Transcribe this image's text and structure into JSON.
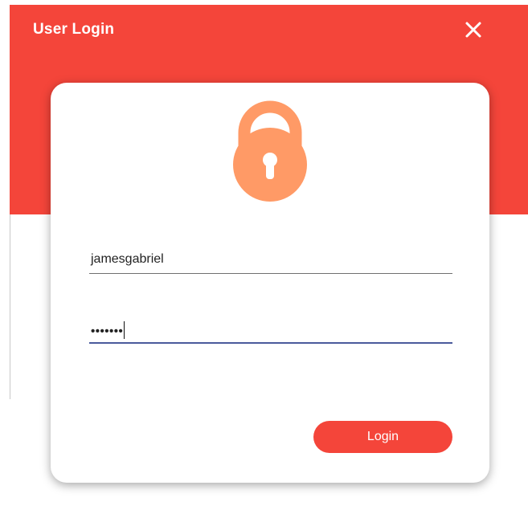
{
  "window": {
    "title": "User Login",
    "accent_color": "#f4453a"
  },
  "icons": {
    "close": "close-icon",
    "lock": "lock-icon",
    "lock_color": "#ff9a66"
  },
  "form": {
    "username_value": "jamesgabriel",
    "password_value": "•••••••",
    "login_label": "Login"
  }
}
